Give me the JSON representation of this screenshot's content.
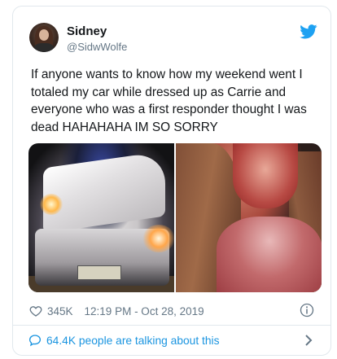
{
  "tweet": {
    "author": {
      "name": "Sidney",
      "handle": "@SidwWolfe"
    },
    "text": "If anyone wants to know how my weekend went I totaled my car while dressed up as Carrie and everyone who was a first responder thought I was dead HAHAHAHA IM SO SORRY",
    "media": [
      {
        "description_icon": "crashed-car-photo"
      },
      {
        "description_icon": "carrie-costume-photo"
      }
    ],
    "likes": "345K",
    "timestamp": "12:19 PM - Oct 28, 2019",
    "conversation": "64.4K people are talking about this"
  },
  "icons": {
    "brand": "twitter-bird-icon",
    "like": "heart-icon",
    "info": "info-icon",
    "conversation": "speech-bubble-icon",
    "more": "chevron-right-icon"
  },
  "colors": {
    "brand_blue": "#1da1f2",
    "link_blue": "#1b95e0",
    "secondary_text": "#657786",
    "border": "#e1e8ed",
    "primary_text": "#14171a"
  }
}
